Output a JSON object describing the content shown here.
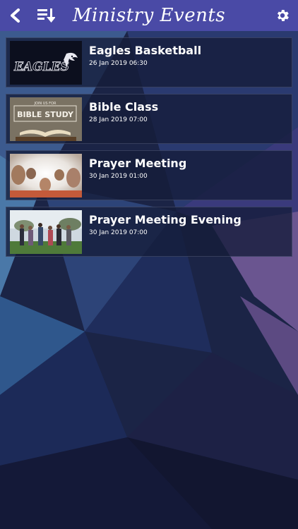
{
  "header": {
    "title": "Ministry Events",
    "back_icon": "chevron-left-icon",
    "sort_icon": "sort-descending-icon",
    "settings_icon": "gear-icon"
  },
  "events": [
    {
      "title": "Eagles Basketball",
      "date": "26 Jan 2019 06:30",
      "thumb_text": "EAGLES"
    },
    {
      "title": "Bible Class",
      "date": "28 Jan 2019 07:00",
      "thumb_text": "BIBLE STUDY",
      "thumb_subtext": "JOIN US FOR"
    },
    {
      "title": "Prayer Meeting",
      "date": "30 Jan 2019 01:00"
    },
    {
      "title": "Prayer Meeting Evening",
      "date": "30 Jan 2019 07:00"
    }
  ],
  "colors": {
    "header": "#4a4aa6",
    "card": "#141c3a"
  }
}
